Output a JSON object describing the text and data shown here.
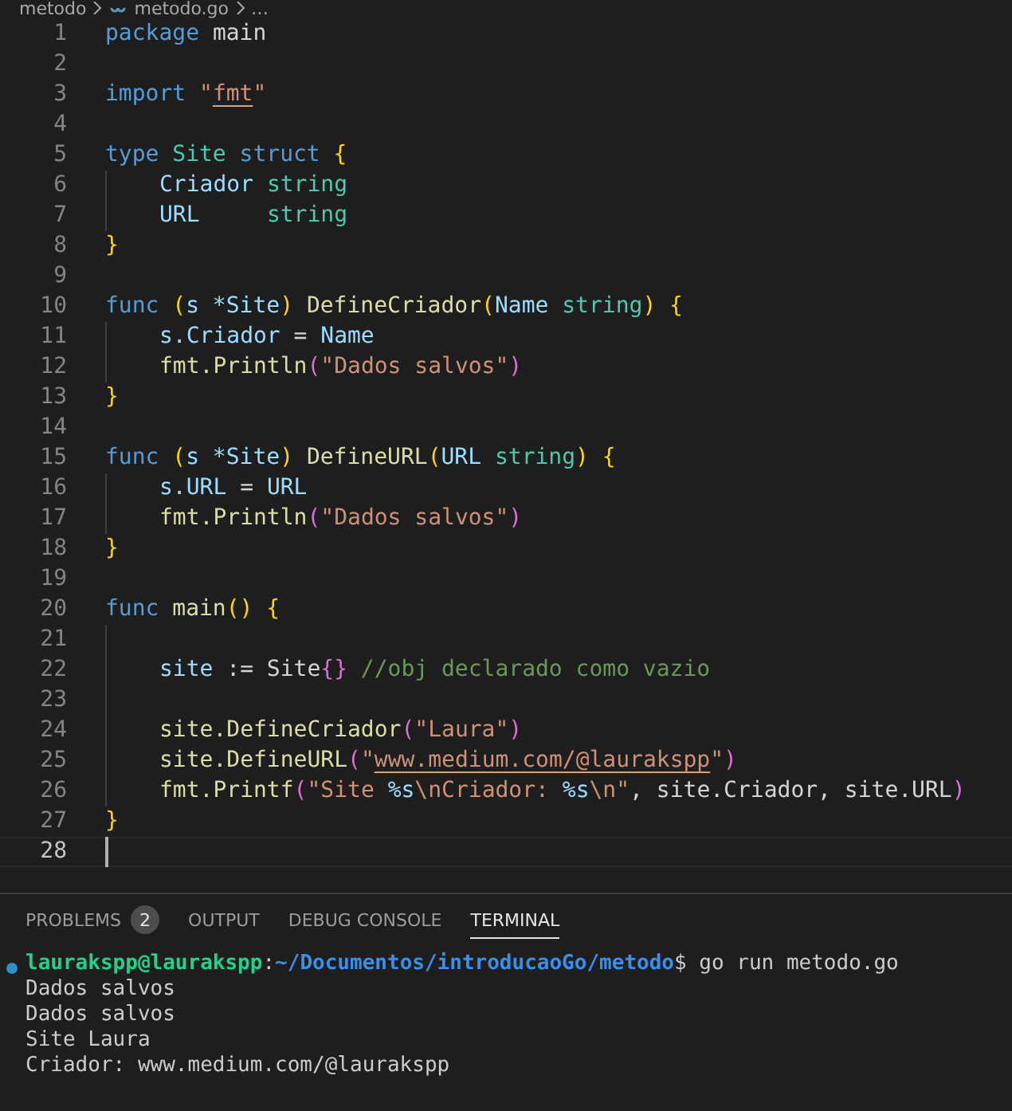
{
  "breadcrumb": [
    {
      "kind": "folder",
      "label": "metodo"
    },
    {
      "kind": "file",
      "label": "metodo.go"
    },
    {
      "kind": "more",
      "label": "…"
    }
  ],
  "editor": {
    "lines": [
      {
        "number": "1",
        "tokens": [
          {
            "kind": "keyword",
            "text": "package"
          },
          {
            "kind": "plain",
            "text": "main",
            "space": true
          }
        ]
      },
      {
        "number": "2"
      },
      {
        "number": "3",
        "tokens": [
          {
            "kind": "keyword",
            "text": "import"
          },
          {
            "kind": "string",
            "text": "\"",
            "space": true
          },
          {
            "kind": "string",
            "text": "fmt",
            "underline": true
          },
          {
            "kind": "string",
            "text": "\""
          }
        ]
      },
      {
        "number": "4"
      },
      {
        "number": "5",
        "tokens": [
          {
            "kind": "keyword",
            "text": "type"
          },
          {
            "kind": "type",
            "text": "Site",
            "space": true
          },
          {
            "kind": "keyword",
            "text": "struct",
            "space": true
          },
          {
            "kind": "bracket1",
            "text": "{",
            "space": true
          }
        ]
      },
      {
        "number": "6",
        "indented": true,
        "tokens": [
          {
            "kind": "variable",
            "text": "Criador"
          },
          {
            "kind": "type",
            "text": "string",
            "space": true
          }
        ]
      },
      {
        "number": "7",
        "indented": true,
        "tokens": [
          {
            "kind": "variable",
            "text": "URL"
          },
          {
            "kind": "type",
            "text": "string",
            "aligned": true
          }
        ]
      },
      {
        "number": "8",
        "tokens": [
          {
            "kind": "bracket1",
            "text": "}"
          }
        ]
      },
      {
        "number": "9"
      },
      {
        "number": "10",
        "tokens": [
          {
            "kind": "keyword",
            "text": "func"
          },
          {
            "kind": "bracket1",
            "text": "(",
            "space": true
          },
          {
            "kind": "variable",
            "text": "s *Site"
          },
          {
            "kind": "bracket1",
            "text": ")"
          },
          {
            "kind": "function",
            "text": "DefineCriador",
            "space": true
          },
          {
            "kind": "bracket1",
            "text": "("
          },
          {
            "kind": "variable",
            "text": "Name"
          },
          {
            "kind": "type",
            "text": "string",
            "space": true
          },
          {
            "kind": "bracket1",
            "text": ")"
          },
          {
            "kind": "bracket1",
            "text": "{",
            "space": true
          }
        ]
      },
      {
        "number": "11",
        "indented": true,
        "tokens": [
          {
            "kind": "variable",
            "text": "s.Criador"
          },
          {
            "kind": "plain",
            "text": "=",
            "space": true
          },
          {
            "kind": "variable",
            "text": "Name",
            "space": true
          }
        ]
      },
      {
        "number": "12",
        "indented": true,
        "tokens": [
          {
            "kind": "function",
            "text": "fmt.Println"
          },
          {
            "kind": "bracket2",
            "text": "("
          },
          {
            "kind": "string",
            "text": "\"Dados salvos\""
          },
          {
            "kind": "bracket2",
            "text": ")"
          }
        ]
      },
      {
        "number": "13",
        "tokens": [
          {
            "kind": "bracket1",
            "text": "}"
          }
        ]
      },
      {
        "number": "14"
      },
      {
        "number": "15",
        "tokens": [
          {
            "kind": "keyword",
            "text": "func"
          },
          {
            "kind": "bracket1",
            "text": "(",
            "space": true
          },
          {
            "kind": "variable",
            "text": "s *Site"
          },
          {
            "kind": "bracket1",
            "text": ")"
          },
          {
            "kind": "function",
            "text": "DefineURL",
            "space": true
          },
          {
            "kind": "bracket1",
            "text": "("
          },
          {
            "kind": "variable",
            "text": "URL"
          },
          {
            "kind": "type",
            "text": "string",
            "space": true
          },
          {
            "kind": "bracket1",
            "text": ")"
          },
          {
            "kind": "bracket1",
            "text": "{",
            "space": true
          }
        ]
      },
      {
        "number": "16",
        "indented": true,
        "tokens": [
          {
            "kind": "variable",
            "text": "s.URL"
          },
          {
            "kind": "plain",
            "text": "=",
            "space": true
          },
          {
            "kind": "variable",
            "text": "URL",
            "space": true
          }
        ]
      },
      {
        "number": "17",
        "indented": true,
        "tokens": [
          {
            "kind": "function",
            "text": "fmt.Println"
          },
          {
            "kind": "bracket2",
            "text": "("
          },
          {
            "kind": "string",
            "text": "\"Dados salvos\""
          },
          {
            "kind": "bracket2",
            "text": ")"
          }
        ]
      },
      {
        "number": "18",
        "tokens": [
          {
            "kind": "bracket1",
            "text": "}"
          }
        ]
      },
      {
        "number": "19"
      },
      {
        "number": "20",
        "tokens": [
          {
            "kind": "keyword",
            "text": "func"
          },
          {
            "kind": "function",
            "text": "main",
            "space": true
          },
          {
            "kind": "bracket1",
            "text": "()"
          },
          {
            "kind": "bracket1",
            "text": "{",
            "space": true
          }
        ]
      },
      {
        "number": "21",
        "indented": true
      },
      {
        "number": "22",
        "indented": true,
        "tokens": [
          {
            "kind": "variable",
            "text": "site"
          },
          {
            "kind": "plain",
            "text": ":=",
            "space": true
          },
          {
            "kind": "plain",
            "text": "Site",
            "space": true
          },
          {
            "kind": "bracket2",
            "text": "{}"
          },
          {
            "kind": "comment",
            "text": "//obj declarado como vazio",
            "space": true
          }
        ]
      },
      {
        "number": "23",
        "indented": true
      },
      {
        "number": "24",
        "indented": true,
        "tokens": [
          {
            "kind": "function",
            "text": "site.DefineCriador"
          },
          {
            "kind": "bracket2",
            "text": "("
          },
          {
            "kind": "string",
            "text": "\"Laura\""
          },
          {
            "kind": "bracket2",
            "text": ")"
          }
        ]
      },
      {
        "number": "25",
        "indented": true,
        "tokens": [
          {
            "kind": "function",
            "text": "site.DefineURL"
          },
          {
            "kind": "bracket2",
            "text": "("
          },
          {
            "kind": "string",
            "text": "\""
          },
          {
            "kind": "string",
            "text": "www.medium.com/@laurakspp",
            "underline": true
          },
          {
            "kind": "string",
            "text": "\""
          },
          {
            "kind": "bracket2",
            "text": ")"
          }
        ]
      },
      {
        "number": "26",
        "indented": true,
        "tokens": [
          {
            "kind": "function",
            "text": "fmt.Printf"
          },
          {
            "kind": "bracket2",
            "text": "("
          },
          {
            "kind": "string",
            "text": "\"Site"
          },
          {
            "kind": "variable",
            "text": "%s",
            "space": true
          },
          {
            "kind": "string",
            "text": "\\nCriador:"
          },
          {
            "kind": "variable",
            "text": "%s",
            "space": true
          },
          {
            "kind": "string",
            "text": "\\n\""
          },
          {
            "kind": "plain",
            "text": ", site.Criador, site.URL"
          },
          {
            "kind": "bracket2",
            "text": ")"
          }
        ]
      },
      {
        "number": "27",
        "tokens": [
          {
            "kind": "bracket1",
            "text": "}"
          }
        ]
      },
      {
        "number": "28",
        "current": true
      }
    ]
  },
  "panel": {
    "tabs": [
      {
        "label": "PROBLEMS",
        "badge": "2",
        "selected": false
      },
      {
        "label": "OUTPUT",
        "selected": false
      },
      {
        "label": "DEBUG CONSOLE",
        "selected": false
      },
      {
        "label": "TERMINAL",
        "selected": true
      }
    ],
    "terminal": {
      "prompt": {
        "user": "laurakspp@laurakspp",
        "separator": ":",
        "path": "~/Documentos/introducaoGo/metodo",
        "command": "$ go run metodo.go"
      },
      "output": [
        "Dados salvos",
        "Dados salvos",
        "Site Laura",
        "Criador: www.medium.com/@laurakspp"
      ]
    }
  }
}
